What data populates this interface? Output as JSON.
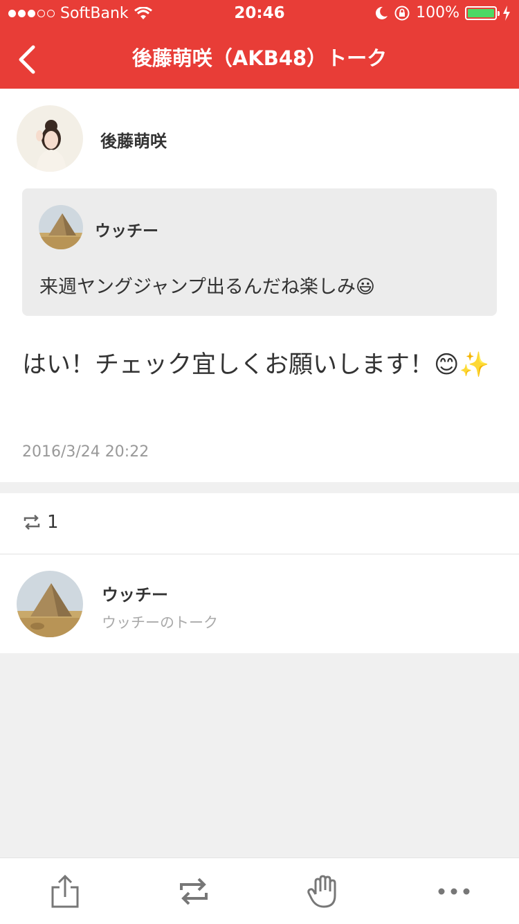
{
  "status_bar": {
    "carrier": "SoftBank",
    "time": "20:46",
    "battery": "100%"
  },
  "header": {
    "title": "後藤萌咲（AKB48）トーク"
  },
  "post": {
    "author": "後藤萌咲",
    "quote": {
      "author": "ウッチー",
      "text": "来週ヤングジャンプ出るんだね楽しみ😃"
    },
    "text": "はい！チェック宜しくお願いします！😊✨",
    "timestamp": "2016/3/24 20:22"
  },
  "reposts": {
    "count": "1",
    "users": [
      {
        "name": "ウッチー",
        "subtitle": "ウッチーのトーク"
      }
    ]
  },
  "toolbar": {
    "icons": [
      "share-icon",
      "repost-icon",
      "hand-icon",
      "more-icon"
    ]
  },
  "colors": {
    "brand_red": "#e83d37",
    "battery_green": "#4cd964",
    "quote_bg": "#ececec",
    "page_bg": "#f0f0f0"
  }
}
